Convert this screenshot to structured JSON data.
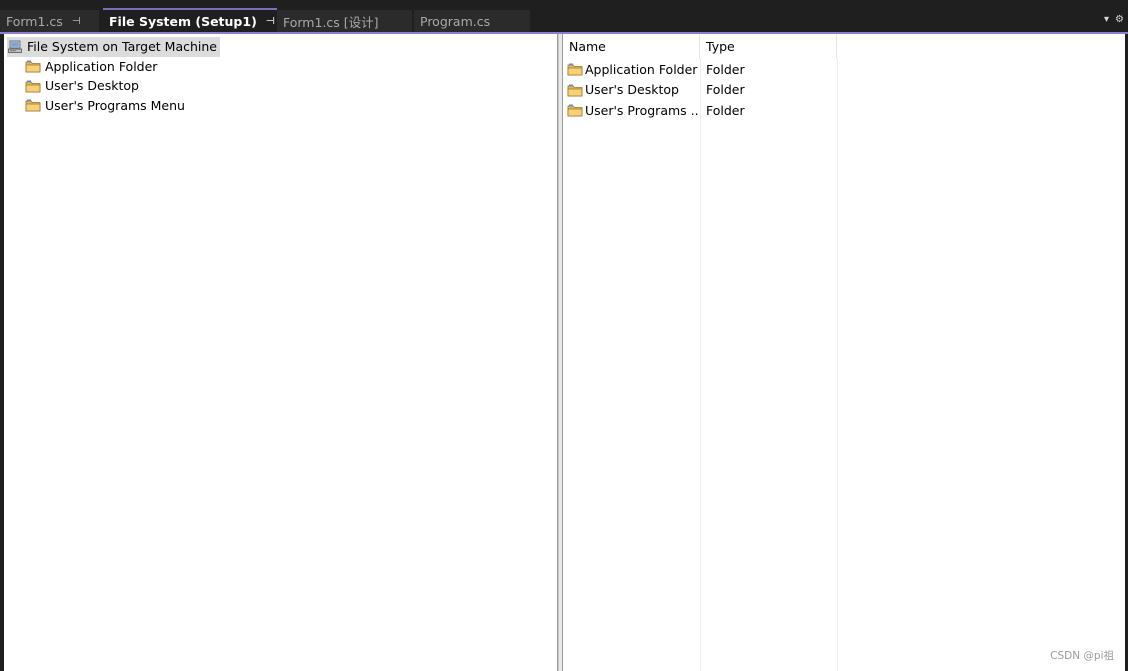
{
  "tabs": [
    {
      "label": "Form1.cs",
      "pin": "⊣",
      "active": false
    },
    {
      "label": "File System (Setup1)",
      "pin": "⊣",
      "close": "✕",
      "active": true
    },
    {
      "label": "Form1.cs [设计]",
      "active": false
    },
    {
      "label": "Program.cs",
      "active": false
    }
  ],
  "tabstrip_controls": {
    "dropdown": "▾",
    "settings": "⚙"
  },
  "tree": {
    "root": {
      "label": "File System on Target Machine",
      "icon": "computer-icon"
    },
    "children": [
      {
        "label": "Application Folder",
        "icon": "folder-icon"
      },
      {
        "label": "User's Desktop",
        "icon": "folder-icon"
      },
      {
        "label": "User's Programs Menu",
        "icon": "folder-icon"
      }
    ]
  },
  "list": {
    "columns": [
      "Name",
      "Type"
    ],
    "rows": [
      {
        "name": "Application Folder",
        "type": "Folder",
        "icon": "folder-icon"
      },
      {
        "name": "User's Desktop",
        "type": "Folder",
        "icon": "folder-icon"
      },
      {
        "name": "User's Programs ...",
        "type": "Folder",
        "icon": "folder-icon"
      }
    ]
  },
  "watermark": "CSDN @pi祖",
  "colors": {
    "tab_accent": "#7a6ec0",
    "folder": "#e8b84a",
    "root_highlight": "#dcdcdc"
  }
}
